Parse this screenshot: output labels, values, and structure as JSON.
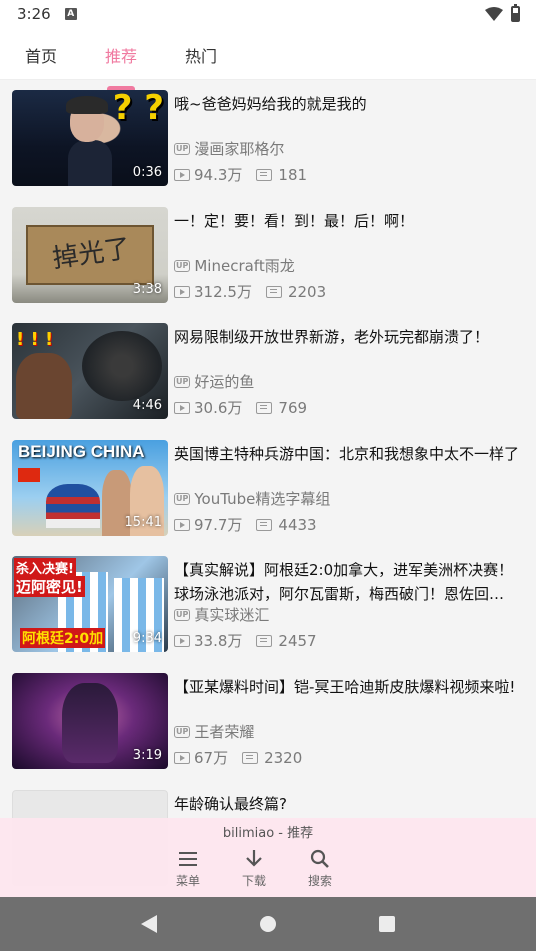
{
  "status_bar": {
    "time": "3:26",
    "a_icon": "A"
  },
  "tabs": [
    {
      "label": "首页",
      "active": false
    },
    {
      "label": "推荐",
      "active": true
    },
    {
      "label": "热门",
      "active": false
    }
  ],
  "colors": {
    "accent": "#f07aa0"
  },
  "videos": [
    {
      "title": "哦~爸爸妈妈给我的就是我的",
      "author": "漫画家耶格尔",
      "views": "94.3万",
      "danmaku": "181",
      "duration": "0:36"
    },
    {
      "title": "一！定！要！看！到！最！后！啊！",
      "author": "Minecraft雨龙",
      "views": "312.5万",
      "danmaku": "2203",
      "duration": "3:38"
    },
    {
      "title": "网易限制级开放世界新游，老外玩完都崩溃了！",
      "author": "好运的鱼",
      "views": "30.6万",
      "danmaku": "769",
      "duration": "4:46"
    },
    {
      "title": "英国博主特种兵游中国：北京和我想象中太不一样了",
      "author": "YouTube精选字幕组",
      "views": "97.7万",
      "danmaku": "4433",
      "duration": "15:41"
    },
    {
      "title": "【真实解说】阿根廷2:0加拿大，进军美洲杯决赛！球场泳池派对，阿尔瓦雷斯，梅西破门！恩佐回…",
      "author": "真实球迷汇",
      "views": "33.8万",
      "danmaku": "2457",
      "duration": "9:34"
    },
    {
      "title": "【亚某爆料时间】铠-冥王哈迪斯皮肤爆料视频来啦!",
      "author": "王者荣耀",
      "views": "67万",
      "danmaku": "2320",
      "duration": "3:19"
    },
    {
      "title": "年龄确认最终篇?",
      "author": "",
      "views": "",
      "danmaku": "",
      "duration": ""
    }
  ],
  "thumb_text": {
    "v1": "? ?",
    "v2": "掉光了",
    "v3": "! ! !",
    "v4": "BEIJING CHINA",
    "v5_line1": "杀入决赛!",
    "v5_line2": "迈阿密见!",
    "v5_line3": "阿根廷2:0加"
  },
  "bottom_bar": {
    "title": "bilimiao - 推荐",
    "actions": [
      {
        "label": "菜单",
        "icon": "menu-icon"
      },
      {
        "label": "下载",
        "icon": "download-icon"
      },
      {
        "label": "搜索",
        "icon": "search-icon"
      }
    ]
  }
}
